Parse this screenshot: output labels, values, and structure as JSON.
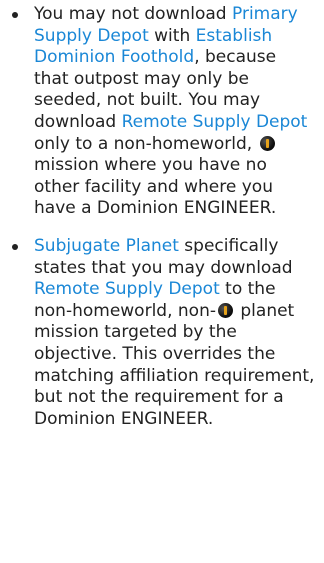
{
  "bullets": [
    {
      "p1": "You may not download ",
      "link1": "Primary Supply Depot",
      "p2": " with ",
      "link2": "Establish Dominion Foothold",
      "p3": ", because that outpost may only be seeded, not built. You may download ",
      "link3": "Remote Supply Depot",
      "p4": " only to a non-homeworld, ",
      "icon": "dominion-icon",
      "p5": " mission where you have no other facility and where you have a Dominion ENGINEER."
    },
    {
      "link1": "Subjugate Planet",
      "p1": " specifically states that you may download ",
      "link2": "Remote Supply Depot",
      "p2": " to the non-homeworld, non-",
      "icon": "dominion-icon",
      "p3": " planet mission targeted by the objective. This overrides the matching affiliation requirement, but not the requirement for a Dominion ENGINEER."
    }
  ],
  "colors": {
    "text": "#222222",
    "link": "#1a87d6"
  }
}
